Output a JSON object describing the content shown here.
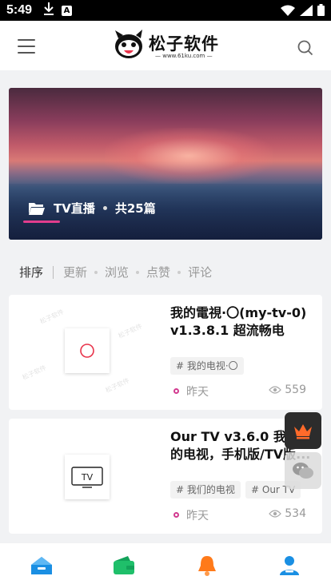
{
  "status_bar": {
    "time": "5:49",
    "icons": [
      "download-icon",
      "app-a-icon",
      "wifi-icon",
      "signal-icon",
      "battery-icon"
    ]
  },
  "header": {
    "logo_text": "松子软件",
    "logo_url": "— www.61ku.com —",
    "icons": [
      "menu-icon",
      "search-icon"
    ]
  },
  "banner": {
    "title": "TV直播",
    "count": "共25篇",
    "icon": "folder-icon",
    "accent": "#e23d8d"
  },
  "sort_bar": {
    "active": "排序",
    "options": [
      "更新",
      "浏览",
      "点赞",
      "评论"
    ]
  },
  "posts": [
    {
      "title": "我的電視·〇(my-tv-0) v1.3.8.1 超流畅电视...",
      "tag": "# 我的电视·〇",
      "date": "昨天",
      "views": "559",
      "thumb_icon": "circle-icon",
      "watermark": "松子软件"
    },
    {
      "title": "Our TV v3.6.0 我们的电视，手机版/TV版...",
      "tags": [
        "# 我们的电视",
        "# Our TV"
      ],
      "date": "昨天",
      "views": "534",
      "thumb_icon": "tv-icon",
      "thumb_label": "TV"
    }
  ],
  "floating": [
    "crown-icon",
    "wechat-icon"
  ],
  "tab_bar": [
    "home-icon",
    "wallet-icon",
    "bell-icon",
    "user-icon"
  ],
  "colors": {
    "accent": "#e23d8d",
    "tab_blue": "#1a8fe3",
    "tab_green": "#1fbf6a",
    "tab_orange": "#ff7a1a",
    "crown": "#ff6a2a"
  }
}
